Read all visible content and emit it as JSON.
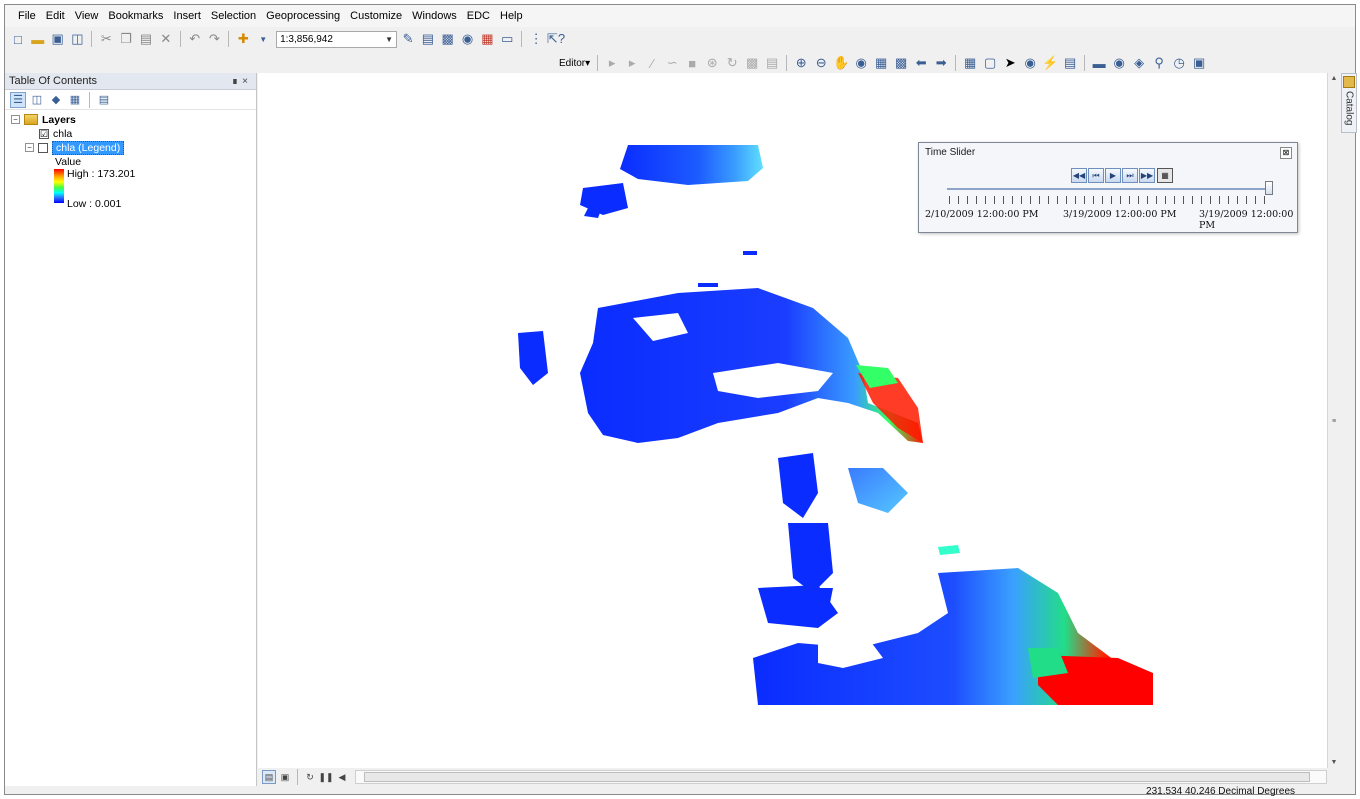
{
  "menu": [
    {
      "label": "File"
    },
    {
      "label": "Edit"
    },
    {
      "label": "View"
    },
    {
      "label": "Bookmarks"
    },
    {
      "label": "Insert"
    },
    {
      "label": "Selection"
    },
    {
      "label": "Geoprocessing"
    },
    {
      "label": "Customize"
    },
    {
      "label": "Windows"
    },
    {
      "label": "EDC"
    },
    {
      "label": "Help"
    }
  ],
  "toolbar": {
    "scale_value": "1:3,856,942",
    "editor_label": "Editor"
  },
  "toc": {
    "title": "Table Of Contents",
    "pin_close": "ὌC ×",
    "root_label": "Layers",
    "layer1_label": "chla",
    "layer1_checked": "☑",
    "layer2_label": "chla (Legend)",
    "legend_value_label": "Value",
    "legend_high": "High : 173.201",
    "legend_low": "Low : 0.001"
  },
  "catalog": {
    "label": "Catalog"
  },
  "time_slider": {
    "title": "Time Slider",
    "close": "⊠",
    "start_date": "2/10/2009 12:00:00 PM",
    "current_date": "3/19/2009 12:00:00 PM",
    "end_date": "3/19/2009 12:00:00 PM",
    "position": 1.0
  },
  "status": {
    "coordinates": "231.534  40.246 Decimal Degrees"
  },
  "colors": {
    "selection": "#3399ff",
    "map_low": "#0033ff",
    "map_high": "#ff0000"
  }
}
